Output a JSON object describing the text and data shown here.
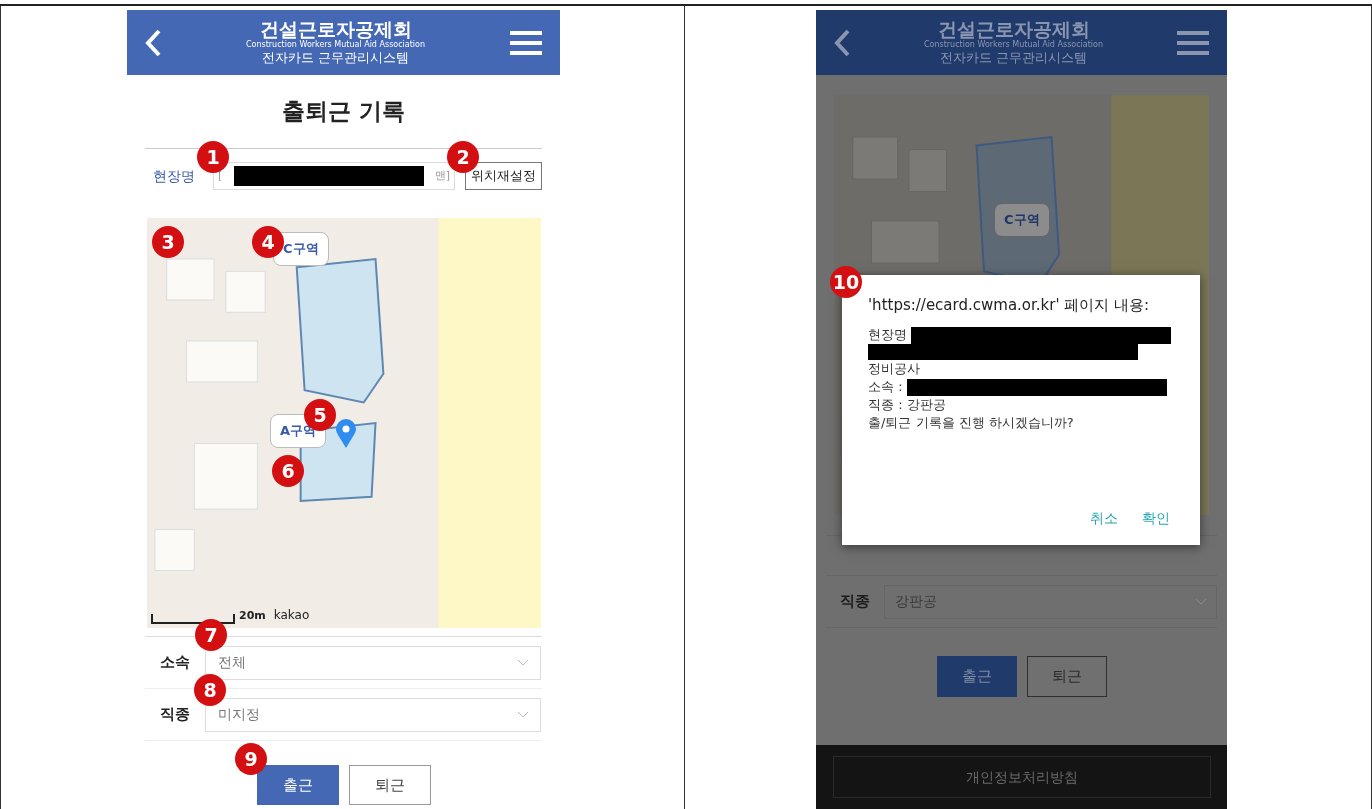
{
  "left_screen": {
    "header": {
      "title": "건설근로자공제회",
      "title_en": "Construction Workers Mutual Aid Association",
      "subtitle": "전자카드 근무관리시스템"
    },
    "page_title": "출퇴근 기록",
    "site_row": {
      "label": "현장명",
      "value_start": "[",
      "value_end": "맨]",
      "redacted": true,
      "button": "위치재설정"
    },
    "map": {
      "zones": [
        {
          "label": "C구역"
        },
        {
          "label": "A구역"
        }
      ],
      "scale": "20m",
      "attribution": "kakao"
    },
    "fields": [
      {
        "label": "소속",
        "value": "전체"
      },
      {
        "label": "직종",
        "value": "미지정"
      }
    ],
    "buttons": [
      {
        "label": "출근",
        "selected": true
      },
      {
        "label": "퇴근",
        "selected": false
      }
    ],
    "badges": [
      "1",
      "2",
      "3",
      "4",
      "5",
      "6",
      "7",
      "8",
      "9"
    ]
  },
  "right_screen": {
    "header": {
      "title": "건설근로자공제회",
      "title_en": "Construction Workers Mutual Aid Association",
      "subtitle": "전자카드 근무관리시스템"
    },
    "map": {
      "zones": [
        {
          "label": "C구역"
        }
      ]
    },
    "fields": [
      {
        "label": "직종",
        "value": "강판공"
      }
    ],
    "buttons": [
      {
        "label": "출근",
        "selected": true
      },
      {
        "label": "퇴근",
        "selected": false
      }
    ],
    "footer_button": "개인정보처리방침",
    "dialog": {
      "heading": "'https://ecard.cwma.or.kr' 페이지 내용:",
      "lines": [
        {
          "kind": "text",
          "text": "현장명",
          "redacted": true
        },
        {
          "kind": "redaction"
        },
        {
          "kind": "text",
          "text": "정비공사",
          "redacted": false
        },
        {
          "kind": "text",
          "text": "소속 :",
          "redacted": true
        },
        {
          "kind": "text",
          "text": "직종 : 강판공",
          "redacted": false
        },
        {
          "kind": "text",
          "text": "출/퇴근 기록을 진행 하시겠습니까?",
          "redacted": false
        }
      ],
      "actions": [
        "취소",
        "확인"
      ]
    },
    "badge": "10"
  }
}
